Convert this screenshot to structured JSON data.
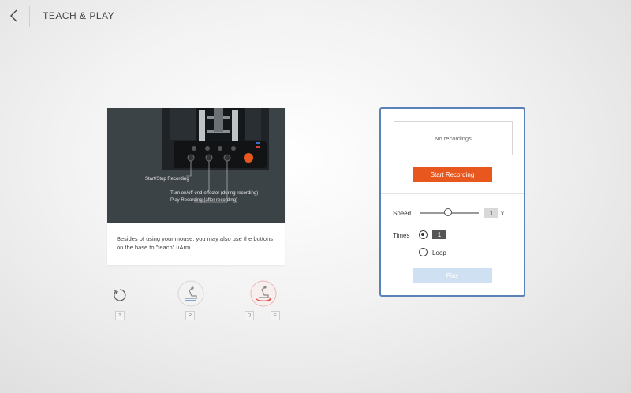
{
  "header": {
    "title": "TEACH & PLAY"
  },
  "card": {
    "label_start_stop": "Start/Stop Recording",
    "label_end_effector": "Turn on/off end-effector (during recording)",
    "label_play": "Play Recording (after recording)",
    "description": "Besides of using your mouse, you may also use the buttons on the base to \"teach\" uArm."
  },
  "shortcuts": {
    "reset_key": "T",
    "record_key": "R",
    "play_key_left": "Q",
    "play_key_right": "E"
  },
  "panel": {
    "empty_text": "No recordings",
    "start_label": "Start Recording",
    "speed_label": "Speed",
    "speed_value": "1",
    "speed_unit": "x",
    "speed_fraction": 0.47,
    "times_label": "Times",
    "times_value": "1",
    "loop_label": "Loop",
    "play_label": "Play"
  },
  "colors": {
    "accent_orange": "#e8571e",
    "panel_border": "#5b82b8",
    "play_disabled": "#cfe0f2"
  }
}
